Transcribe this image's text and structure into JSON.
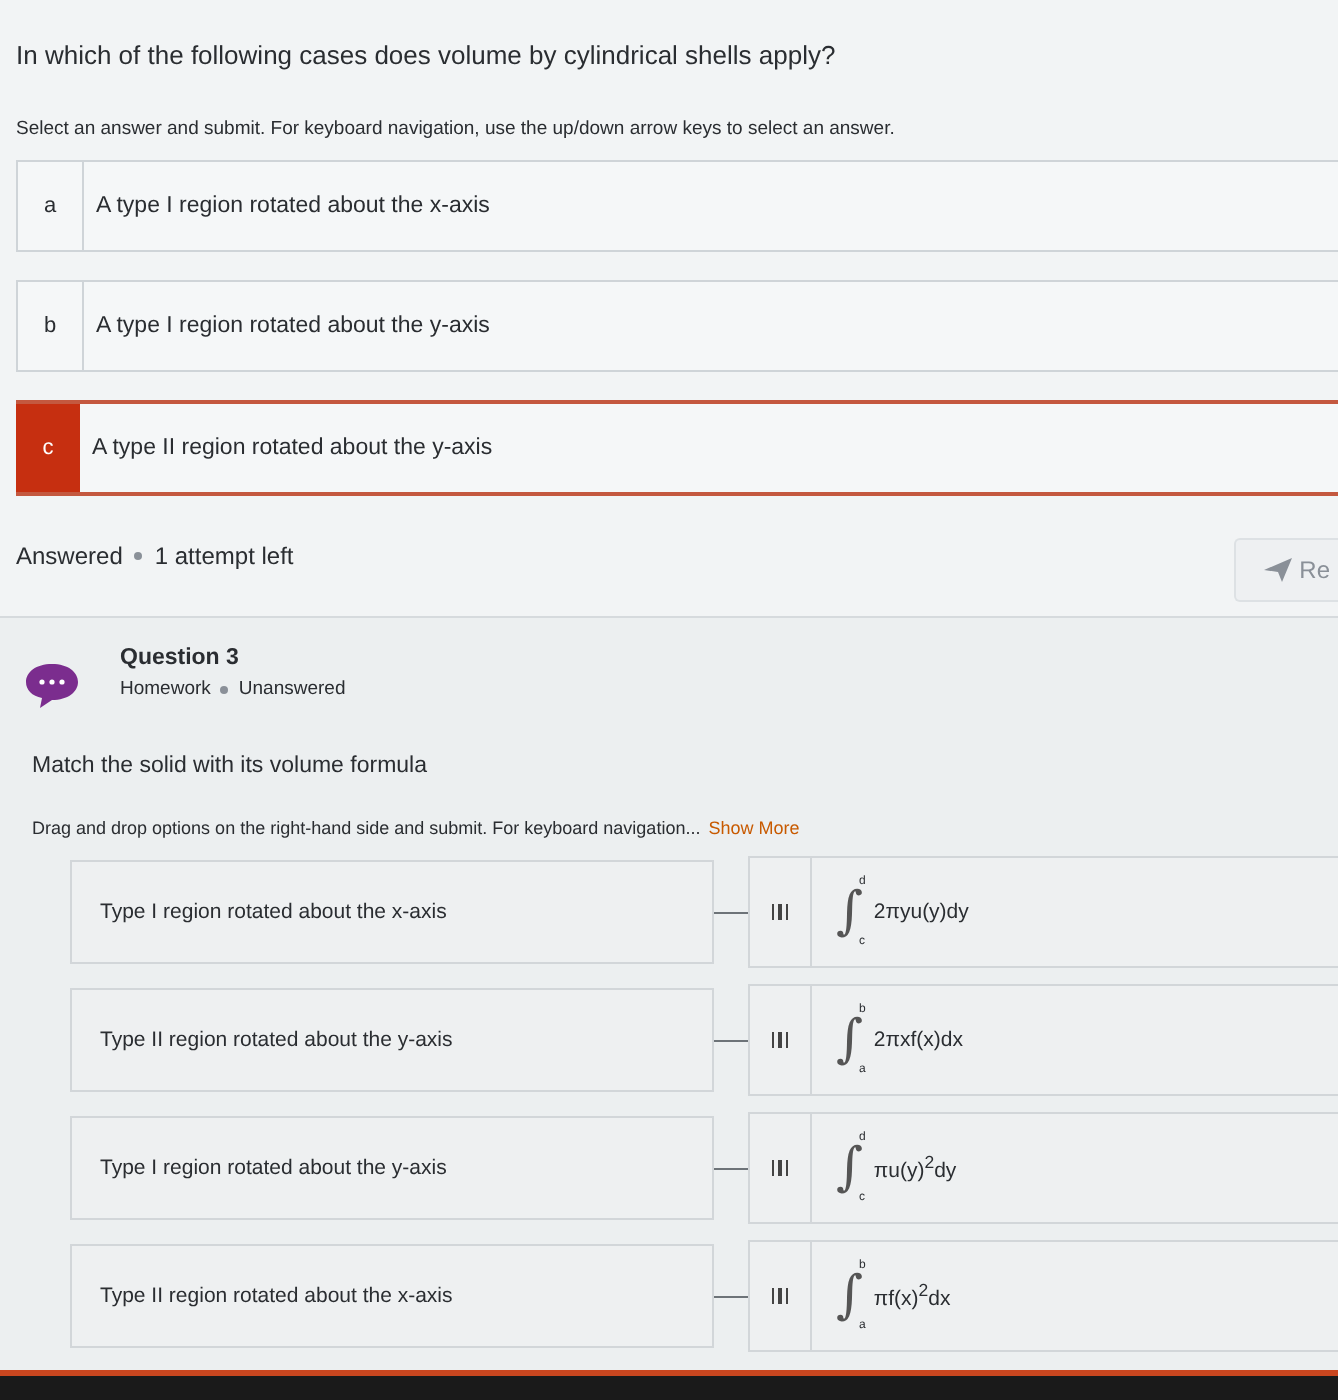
{
  "question_prev": {
    "prompt": "In which of the following cases does volume by cylindrical shells apply?",
    "instructions": "Select an answer and submit. For keyboard navigation, use the up/down arrow keys to select an answer.",
    "options": [
      {
        "letter": "a",
        "text": "A type I region rotated about the x-axis",
        "selected": false
      },
      {
        "letter": "b",
        "text": "A type I region rotated about the y-axis",
        "selected": false
      },
      {
        "letter": "c",
        "text": "A type II region rotated about the y-axis",
        "selected": true
      }
    ],
    "status": "Answered",
    "attempts": "1 attempt left",
    "resubmit_button": "Re"
  },
  "question": {
    "title": "Question 3",
    "category": "Homework",
    "status": "Unanswered",
    "prompt": "Match the solid with its volume formula",
    "instructions": "Drag and drop options on the right-hand side and submit. For keyboard navigation...",
    "show_more": "Show More",
    "pairs": [
      {
        "left": "Type I region rotated about the x-axis",
        "integral": "∫",
        "upper": "d",
        "lower": "c",
        "formula": "2πyu(y)dy"
      },
      {
        "left": "Type II region rotated about the y-axis",
        "integral": "∫",
        "upper": "b",
        "lower": "a",
        "formula": "2πxf(x)dx"
      },
      {
        "left": "Type I region rotated about the y-axis",
        "integral": "∫",
        "upper": "d",
        "lower": "c",
        "formula": "πu(y)$^{2}$dy"
      },
      {
        "left": "Type II region rotated about the x-axis",
        "integral": "∫",
        "upper": "b",
        "lower": "a",
        "formula": "πf(x)$^{2}$dx"
      }
    ]
  }
}
